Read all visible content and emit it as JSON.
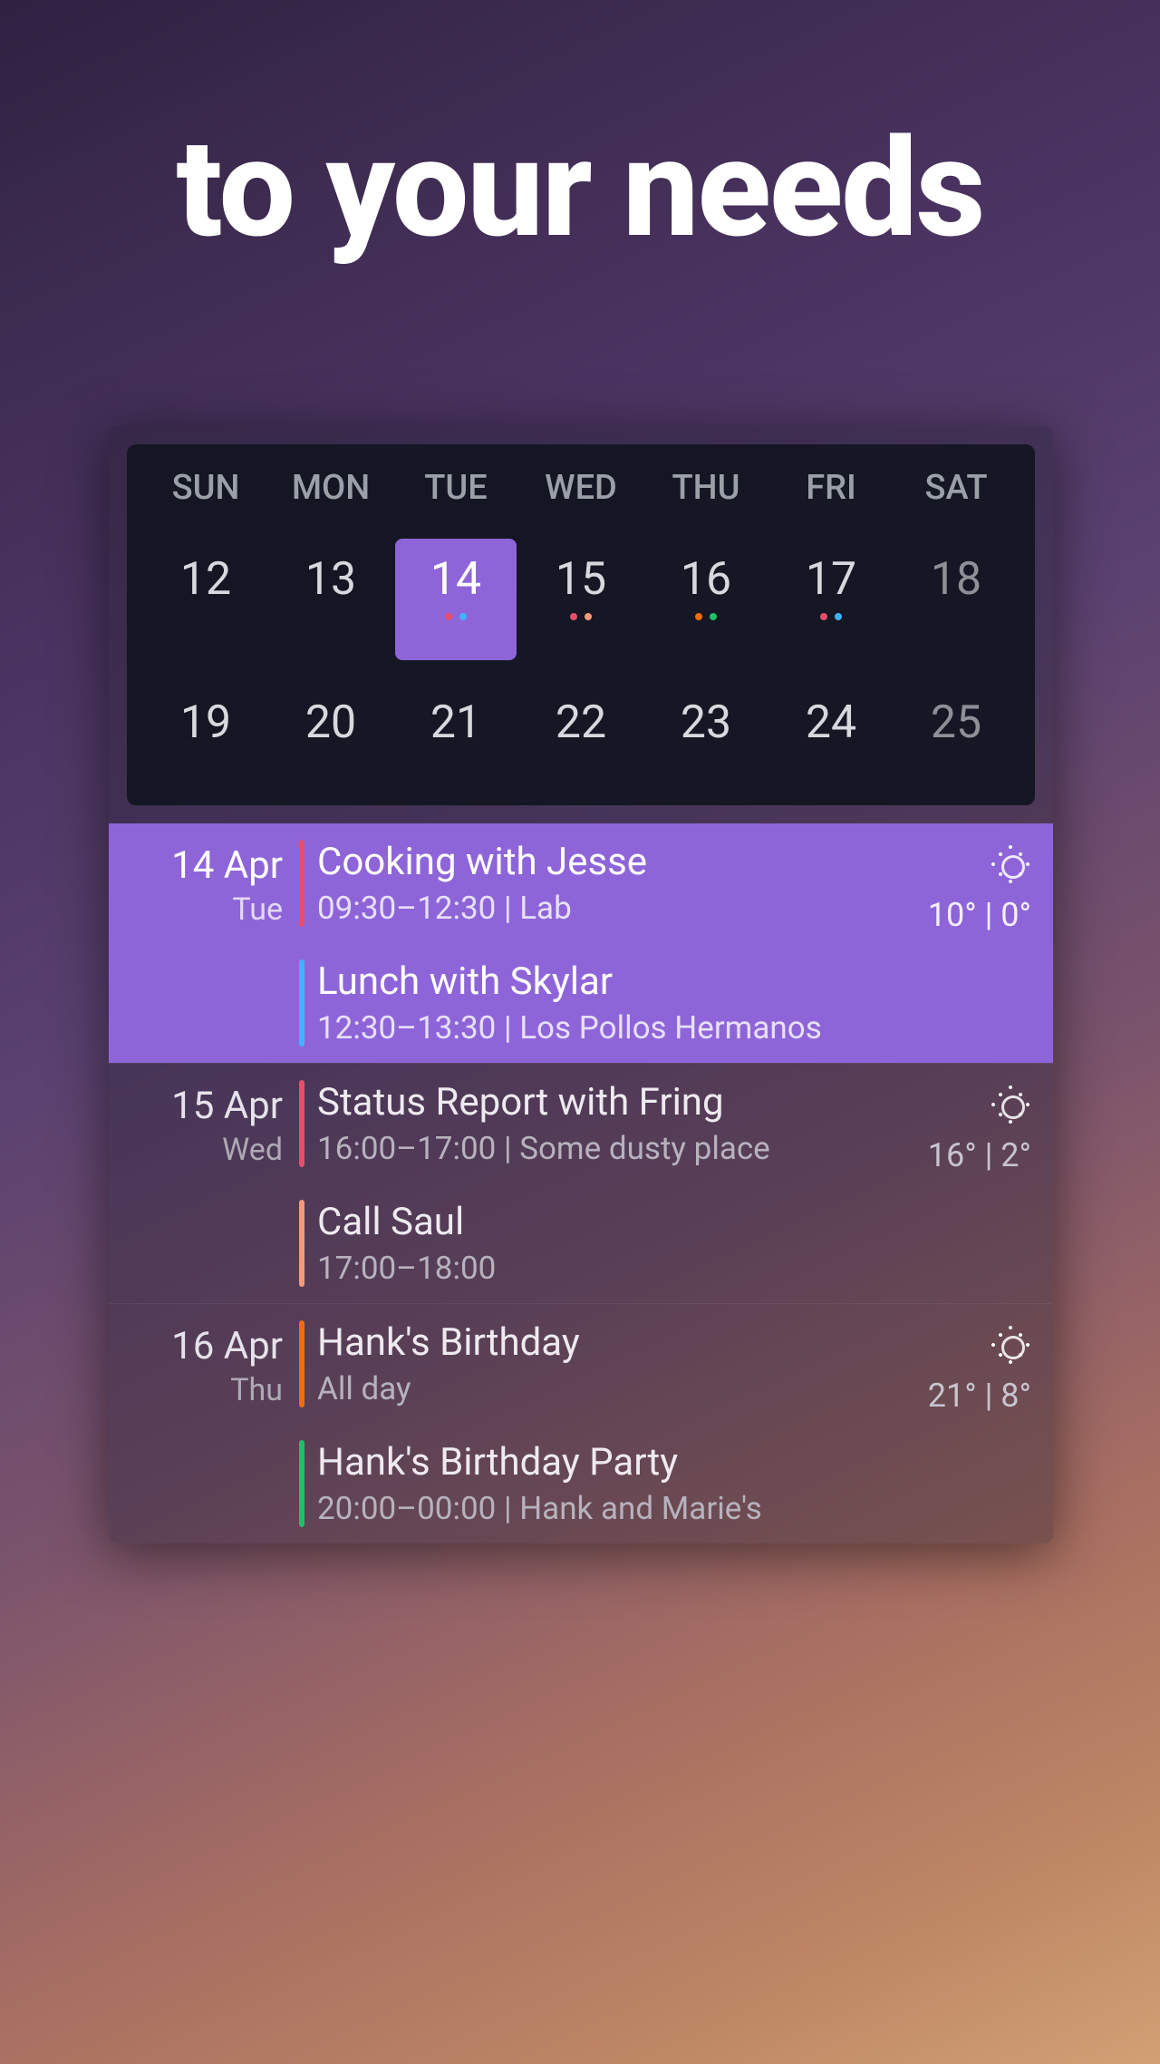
{
  "headline": "to your needs",
  "calendar": {
    "day_names": [
      "SUN",
      "MON",
      "TUE",
      "WED",
      "THU",
      "FRI",
      "SAT"
    ],
    "weeks": [
      [
        {
          "n": 12,
          "muted": false,
          "selected": false,
          "dots": []
        },
        {
          "n": 13,
          "muted": false,
          "selected": false,
          "dots": []
        },
        {
          "n": 14,
          "muted": false,
          "selected": true,
          "dots": [
            "#e84e6b",
            "#3fb3ff"
          ]
        },
        {
          "n": 15,
          "muted": false,
          "selected": false,
          "dots": [
            "#e84e6b",
            "#f39b78"
          ]
        },
        {
          "n": 16,
          "muted": false,
          "selected": false,
          "dots": [
            "#f26d0a",
            "#1cc26a"
          ]
        },
        {
          "n": 17,
          "muted": false,
          "selected": false,
          "dots": [
            "#e84e6b",
            "#3fb3ff"
          ]
        },
        {
          "n": 18,
          "muted": true,
          "selected": false,
          "dots": []
        }
      ],
      [
        {
          "n": 19,
          "muted": false,
          "selected": false,
          "dots": []
        },
        {
          "n": 20,
          "muted": false,
          "selected": false,
          "dots": []
        },
        {
          "n": 21,
          "muted": false,
          "selected": false,
          "dots": []
        },
        {
          "n": 22,
          "muted": false,
          "selected": false,
          "dots": []
        },
        {
          "n": 23,
          "muted": false,
          "selected": false,
          "dots": []
        },
        {
          "n": 24,
          "muted": false,
          "selected": false,
          "dots": []
        },
        {
          "n": 25,
          "muted": true,
          "selected": false,
          "dots": []
        }
      ]
    ]
  },
  "agenda": [
    {
      "date": "14 Apr",
      "weekday": "Tue",
      "today": true,
      "weather": {
        "icon": "sun",
        "temps": "10° | 0°"
      },
      "events": [
        {
          "title": "Cooking with Jesse",
          "subtitle": "09:30–12:30  |  Lab",
          "color": "#e84e6b"
        },
        {
          "title": "Lunch with Skylar",
          "subtitle": "12:30–13:30  |  Los Pollos Hermanos",
          "color": "#3fb3ff"
        }
      ]
    },
    {
      "date": "15 Apr",
      "weekday": "Wed",
      "today": false,
      "weather": {
        "icon": "sun",
        "temps": "16° | 2°"
      },
      "events": [
        {
          "title": "Status Report with Fring",
          "subtitle": "16:00–17:00  |  Some dusty place",
          "color": "#e84e6b"
        },
        {
          "title": "Call Saul",
          "subtitle": "17:00–18:00",
          "color": "#f39b78"
        }
      ]
    },
    {
      "date": "16 Apr",
      "weekday": "Thu",
      "today": false,
      "weather": {
        "icon": "sun",
        "temps": "21° | 8°"
      },
      "events": [
        {
          "title": "Hank's Birthday",
          "subtitle": "All day",
          "color": "#f26d0a"
        },
        {
          "title": "Hank's Birthday Party",
          "subtitle": "20:00–00:00  |  Hank and Marie's",
          "color": "#1cc26a"
        }
      ]
    }
  ]
}
